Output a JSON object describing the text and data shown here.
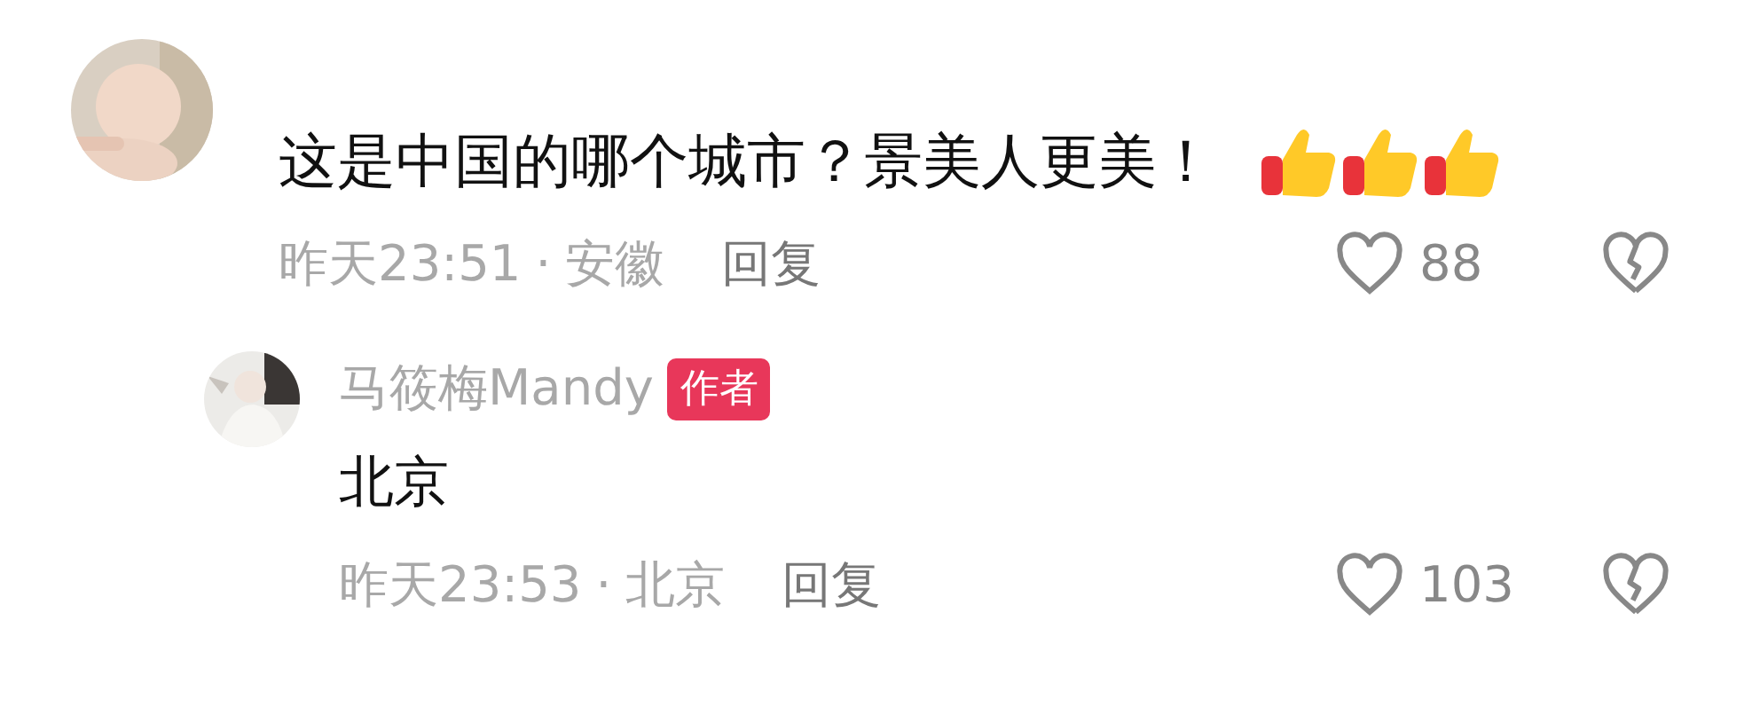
{
  "comments": [
    {
      "text": "这是中国的哪个城市？景美人更美！",
      "emoji": [
        {
          "kind": "thumbs-up"
        },
        {
          "kind": "thumbs-up"
        },
        {
          "kind": "thumbs-up"
        }
      ],
      "time": "昨天23:51",
      "separator": "·",
      "location": "安徽",
      "reply_label": "回复",
      "likes": "88",
      "liked": false,
      "replies": [
        {
          "author": "马筱梅Mandy",
          "badge": "作者",
          "text": "北京",
          "time": "昨天23:53",
          "separator": "·",
          "location": "北京",
          "reply_label": "回复",
          "likes": "103",
          "liked": false
        }
      ]
    }
  ]
}
